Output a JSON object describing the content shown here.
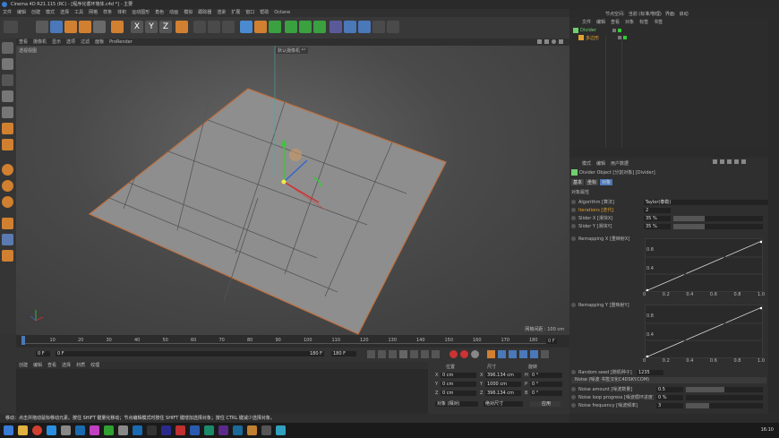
{
  "app": {
    "title": "Cinema 4D R21.115 (RC) - [程序化循环墙体.c4d *] - 主要"
  },
  "menubar": [
    "文件",
    "编辑",
    "创建",
    "模式",
    "选择",
    "工具",
    "网格",
    "样条",
    "体积",
    "运动图形",
    "角色",
    "动画",
    "模拟",
    "跟踪器",
    "渲染",
    "扩展",
    "窗口",
    "帮助",
    "Octane"
  ],
  "viewport": {
    "menu": [
      "查看",
      "摄像机",
      "显示",
      "选项",
      "过滤",
      "面板",
      "ProRender"
    ],
    "label": "透视视图",
    "camera": "默认摄像机 *°",
    "grid_spacing": "网格间距 : 100 cm"
  },
  "timeline": {
    "ticks": [
      "0",
      "10",
      "20",
      "30",
      "40",
      "50",
      "60",
      "70",
      "80",
      "90",
      "100",
      "110",
      "120",
      "130",
      "140",
      "150",
      "160",
      "170",
      "180"
    ],
    "frame": "0 F"
  },
  "transport": {
    "start": "0 F",
    "current": "0 F",
    "end": "180 F",
    "end2": "180 F"
  },
  "material": {
    "menu": [
      "创建",
      "编辑",
      "查看",
      "选择",
      "材质",
      "纹理"
    ]
  },
  "coords": {
    "headers": [
      "位置",
      "尺寸",
      "旋转"
    ],
    "rows": [
      {
        "axis": "X",
        "pos": "0 cm",
        "size": "396.134 cm",
        "rot_axis": "H",
        "rot": "0 °"
      },
      {
        "axis": "Y",
        "pos": "0 cm",
        "size": "1000 cm",
        "rot_axis": "P",
        "rot": "0 °"
      },
      {
        "axis": "Z",
        "pos": "0 cm",
        "size": "396.134 cm",
        "rot_axis": "B",
        "rot": "0 °"
      }
    ],
    "mode1": "对象 (相对)",
    "mode2": "绝对尺寸",
    "apply": "应用"
  },
  "status": "移动：点击并拖动鼠标移动元素。按住 SHIFT 键量化移动；节点编辑模式时按住 SHIFT 键增加选择对象；按住 CTRL 键减少选择对象。",
  "right": {
    "top_tabs": [
      "节点空间:",
      "当前 (标准/物理)",
      "界面:",
      "启动"
    ],
    "obj_menu": [
      "文件",
      "编辑",
      "查看",
      "对象",
      "标签",
      "书签"
    ],
    "objects": [
      {
        "name": "Divider",
        "color": "#6fcf6f"
      },
      {
        "name": "多边形",
        "color": "#e0a030"
      }
    ],
    "attr_menu": [
      "模式",
      "编辑",
      "用户数据"
    ],
    "object_name": "Divider Object [分割对象] [Divider]",
    "attr_tabs": [
      "基本",
      "坐标",
      "对象"
    ],
    "section": "对象属性",
    "params": [
      {
        "label": "Algorithm [算法]",
        "value": "Taylor(泰勒)",
        "type": "dropdown"
      },
      {
        "label": "Iterations [迭代]",
        "value": "2",
        "type": "field",
        "highlight": true
      },
      {
        "label": "Slider X [滑块X]",
        "value": "35 %",
        "type": "slider",
        "fill": 0.35
      },
      {
        "label": "Slider Y [滑块Y]",
        "value": "35 %",
        "type": "slider",
        "fill": 0.35
      }
    ],
    "remap_x": "Remapping X [重映射X]",
    "remap_y": "Remapping Y [重映射Y]",
    "curve_y_ticks": [
      "0.8",
      "0.4"
    ],
    "curve_x_ticks": [
      "0",
      "0.2",
      "0.4",
      "0.6",
      "0.8",
      "1.0"
    ],
    "random_seed": {
      "label": "Random seed [随机种子]",
      "value": "1235"
    },
    "noise_header": "Noise (噪波 书签汉化C4DSKY.COM)",
    "noise_params": [
      {
        "label": "Noise amount [噪波数量]",
        "value": "0.5",
        "fill": 0.5
      },
      {
        "label": "Noise loop progress [噪波循环进度]",
        "value": "0 %",
        "fill": 0.0
      },
      {
        "label": "Noise frequency [噪波频率]",
        "value": "3",
        "fill": 0.3
      }
    ]
  },
  "taskbar": {
    "time": "16:10"
  }
}
